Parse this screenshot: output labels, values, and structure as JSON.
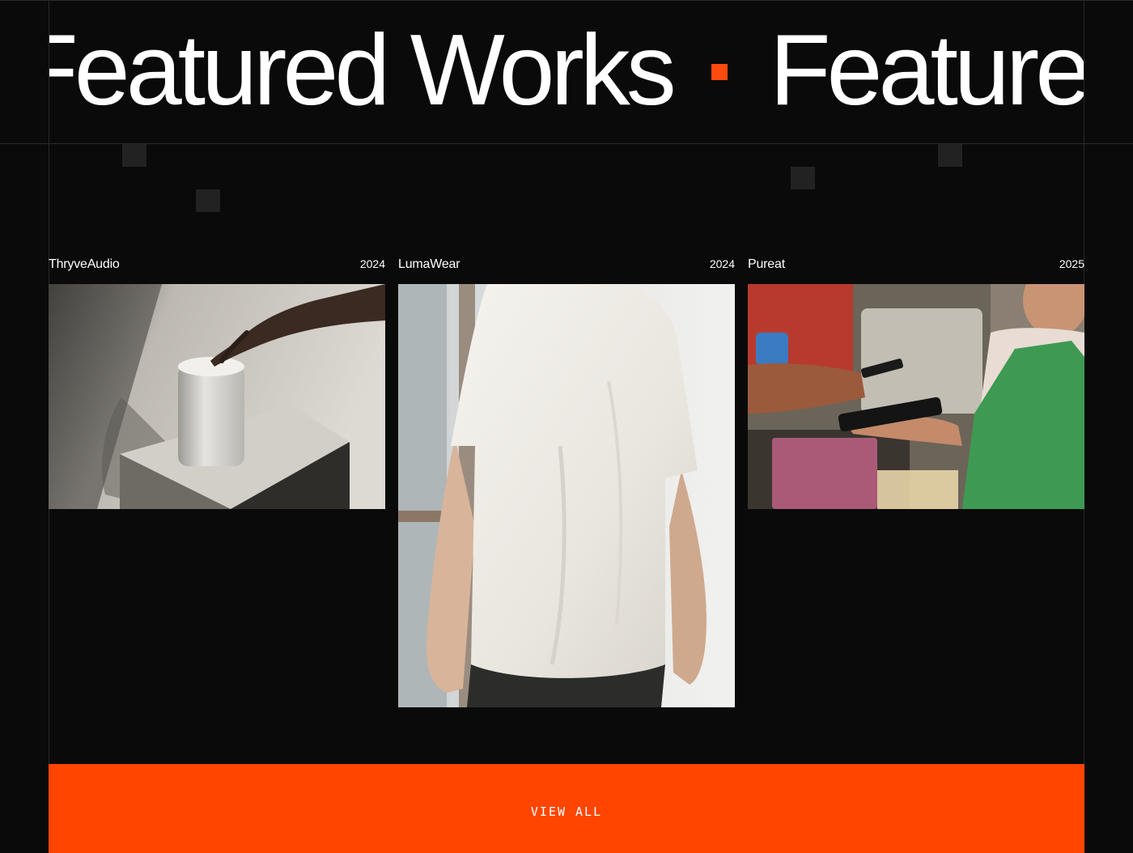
{
  "marquee": {
    "text_1": "Featured Works",
    "text_2": "Featured Works"
  },
  "projects": [
    {
      "name": "ThryveAudio",
      "year": "2024",
      "image_subject": "hand pressing white cylindrical speaker on pedestal"
    },
    {
      "name": "LumaWear",
      "year": "2024",
      "image_subject": "person in white t-shirt seen from behind"
    },
    {
      "name": "Pureat",
      "year": "2025",
      "image_subject": "phone payment at food stall vendor in green apron"
    }
  ],
  "view_all": {
    "label": "VIEW ALL"
  },
  "colors": {
    "background": "#0a0a0a",
    "accent": "#ff4500",
    "text": "#ffffff",
    "grid_line": "#2a2a2a"
  }
}
